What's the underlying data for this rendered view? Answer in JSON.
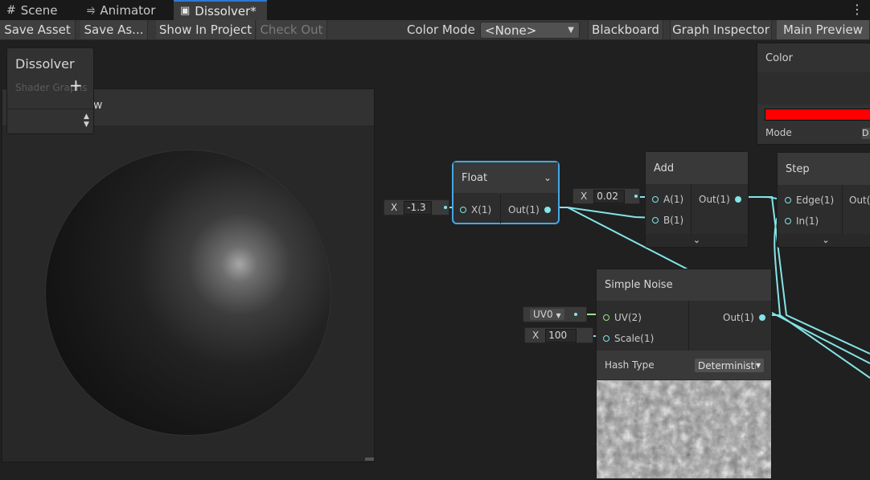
{
  "tabs": [
    {
      "label": "Scene",
      "icon": "grid-icon"
    },
    {
      "label": "Animator",
      "icon": "animator-icon"
    },
    {
      "label": "Dissolver*",
      "icon": "shader-graph-icon"
    }
  ],
  "toolbar": {
    "save_asset": "Save Asset",
    "save_as": "Save As...",
    "show_in_project": "Show In Project",
    "check_out": "Check Out",
    "color_mode_label": "Color Mode",
    "color_mode_value": "<None>",
    "blackboard": "Blackboard",
    "graph_inspector": "Graph Inspector",
    "main_preview": "Main Preview"
  },
  "blackboard": {
    "title": "Dissolver",
    "subtitle": "Shader Graphs"
  },
  "main_preview": {
    "title_fragment": "w"
  },
  "color_panel": {
    "title": "Color",
    "mode_label": "Mode",
    "mode_value_fragment": "D",
    "swatch_color": "#ff0000"
  },
  "float_node": {
    "title": "Float",
    "input": "X(1)",
    "output": "Out(1)",
    "x_label": "X",
    "x_value": "-1.3"
  },
  "add_node": {
    "title": "Add",
    "input_a": "A(1)",
    "input_b": "B(1)",
    "output": "Out(1)",
    "x_label": "X",
    "x_value": "0.02"
  },
  "step_node": {
    "title": "Step",
    "input_edge": "Edge(1)",
    "input_in": "In(1)",
    "output_fragment": "Out("
  },
  "noise_node": {
    "title": "Simple Noise",
    "input_uv": "UV(2)",
    "input_scale": "Scale(1)",
    "output": "Out(1)",
    "uv_value": "UV0",
    "scale_label": "X",
    "scale_value": "100",
    "hash_type_label": "Hash Type",
    "hash_type_value": "Deterministi"
  },
  "colors": {
    "wire": "#84e4e7",
    "selection": "#44a8e6",
    "accent_tab": "#2d7bd6"
  }
}
